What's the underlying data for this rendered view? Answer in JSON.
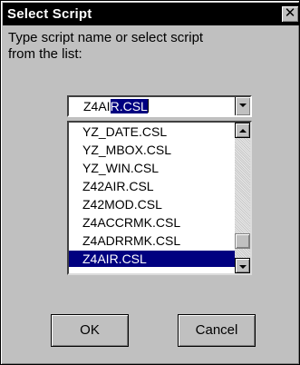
{
  "window": {
    "title": "Select Script",
    "close_glyph": "✕"
  },
  "prompt": {
    "line1": "Type script name or select script",
    "line2": "from the list:"
  },
  "combo": {
    "value_typed": "Z4AI",
    "value_selected": "R.CSL"
  },
  "list": {
    "items": [
      {
        "label": "YZ_DATE.CSL",
        "selected": false
      },
      {
        "label": "YZ_MBOX.CSL",
        "selected": false
      },
      {
        "label": "YZ_WIN.CSL",
        "selected": false
      },
      {
        "label": "Z42AIR.CSL",
        "selected": false
      },
      {
        "label": "Z42MOD.CSL",
        "selected": false
      },
      {
        "label": "Z4ACCRMK.CSL",
        "selected": false
      },
      {
        "label": "Z4ADRRMK.CSL",
        "selected": false
      },
      {
        "label": "Z4AIR.CSL",
        "selected": true
      }
    ]
  },
  "buttons": {
    "ok_label": "OK",
    "cancel_label": "Cancel"
  },
  "colors": {
    "title_bar": "#000000",
    "selection": "#000080",
    "face": "#c0c0c0"
  }
}
